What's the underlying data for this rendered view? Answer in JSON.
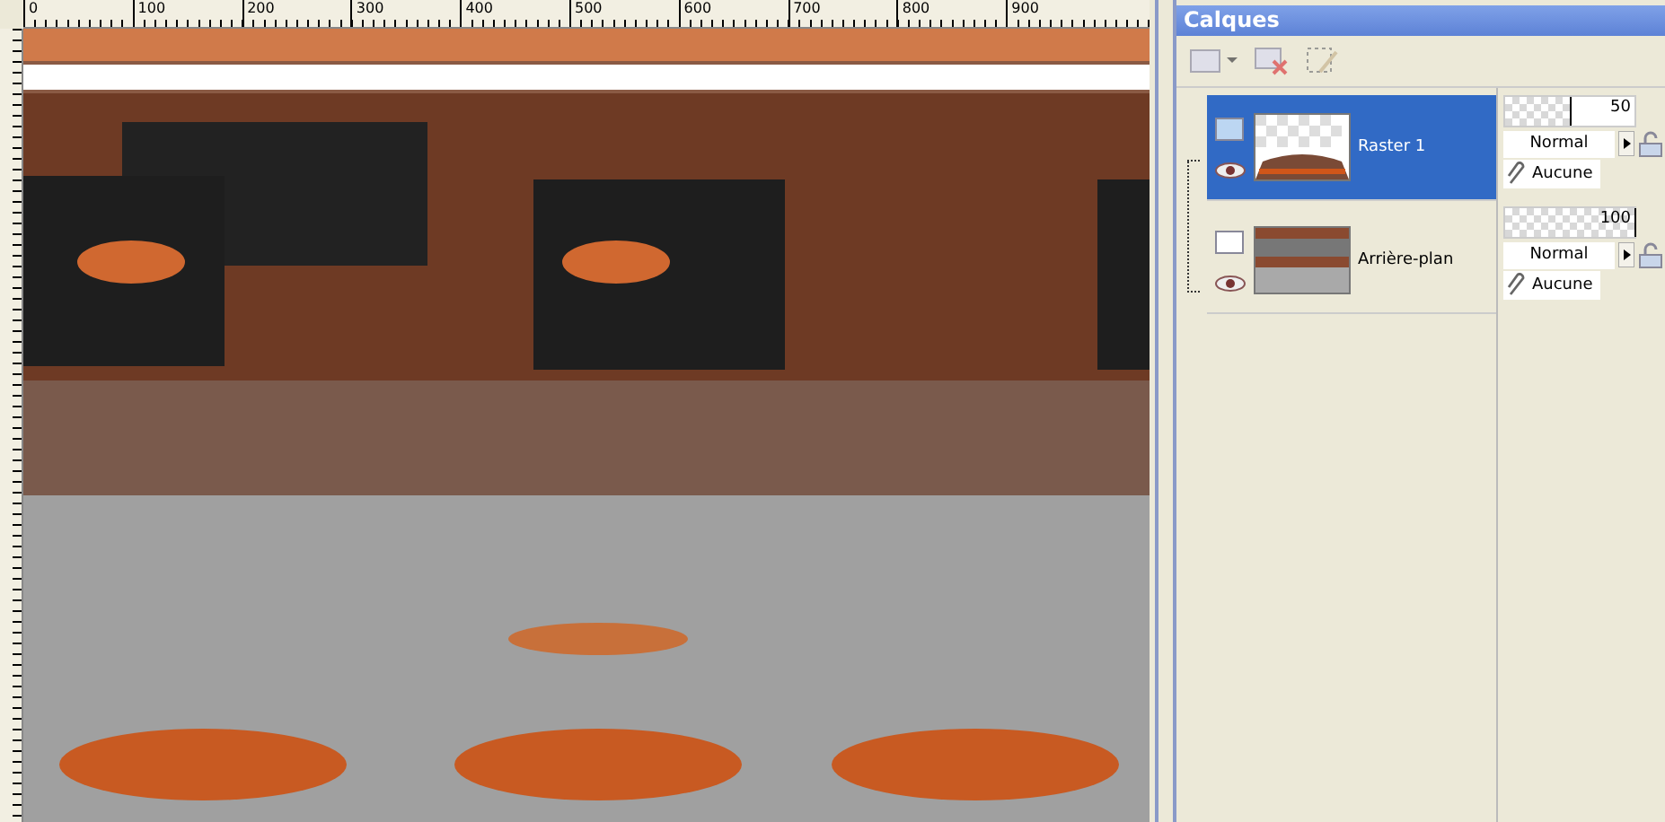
{
  "ruler": {
    "labels": [
      "0",
      "100",
      "200",
      "300",
      "400",
      "500",
      "600",
      "700",
      "800",
      "900"
    ]
  },
  "layers_panel": {
    "title": "Calques",
    "layers": [
      {
        "name": "Raster 1",
        "selected": true,
        "visible": true,
        "opacity": "50",
        "level": 0.5,
        "blend": "Normal",
        "mask": "Aucune",
        "kind": "transparent"
      },
      {
        "name": "Arrière-plan",
        "selected": false,
        "visible": true,
        "opacity": "100",
        "level": 1,
        "blend": "Normal",
        "mask": "Aucune",
        "kind": "full"
      }
    ]
  }
}
